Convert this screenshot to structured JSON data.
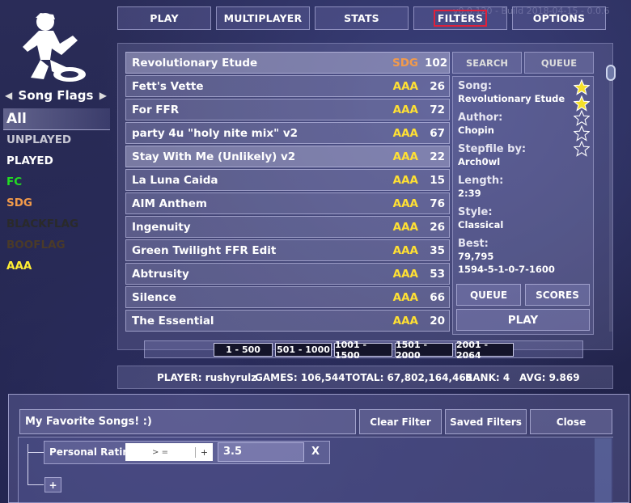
{
  "build_text": "v0.0.120 - Build 2018-04-15 - 0.0.6",
  "nav": {
    "play": "PLAY",
    "multiplayer": "MULTIPLAYER",
    "stats": "STATS",
    "filters": "FILTERS",
    "options": "OPTIONS"
  },
  "sidebar": {
    "title": "Song Flags",
    "items": [
      {
        "label": "All",
        "color": "#ffffff"
      },
      {
        "label": "UNPLAYED",
        "color": "#c8c8d4"
      },
      {
        "label": "PLAYED",
        "color": "#ffffff"
      },
      {
        "label": "FC",
        "color": "#22dd22"
      },
      {
        "label": "SDG",
        "color": "#f29a4a"
      },
      {
        "label": "BLACKFLAG",
        "color": "#2a2a2a"
      },
      {
        "label": "BOOFLAG",
        "color": "#4a3a28"
      },
      {
        "label": "AAA",
        "color": "#ffee33"
      }
    ]
  },
  "songs": [
    {
      "title": "Revolutionary Etude",
      "grade": "SDG",
      "score": "102",
      "grade_color": "#f29a4a"
    },
    {
      "title": "Fett's Vette",
      "grade": "AAA",
      "score": "26",
      "grade_color": "#ffe033"
    },
    {
      "title": "For FFR",
      "grade": "AAA",
      "score": "72",
      "grade_color": "#ffe033"
    },
    {
      "title": "party 4u \"holy nite mix\" v2",
      "grade": "AAA",
      "score": "67",
      "grade_color": "#ffe033"
    },
    {
      "title": "Stay With Me (Unlikely) v2",
      "grade": "AAA",
      "score": "22",
      "grade_color": "#ffe033"
    },
    {
      "title": "La Luna Caida",
      "grade": "AAA",
      "score": "15",
      "grade_color": "#ffe033"
    },
    {
      "title": "AIM Anthem",
      "grade": "AAA",
      "score": "76",
      "grade_color": "#ffe033"
    },
    {
      "title": "Ingenuity",
      "grade": "AAA",
      "score": "26",
      "grade_color": "#ffe033"
    },
    {
      "title": "Green Twilight FFR Edit",
      "grade": "AAA",
      "score": "35",
      "grade_color": "#ffe033"
    },
    {
      "title": "Abtrusity",
      "grade": "AAA",
      "score": "53",
      "grade_color": "#ffe033"
    },
    {
      "title": "Silence",
      "grade": "AAA",
      "score": "66",
      "grade_color": "#ffe033"
    },
    {
      "title": "The Essential",
      "grade": "AAA",
      "score": "20",
      "grade_color": "#ffe033"
    }
  ],
  "tabs": {
    "search": "SEARCH",
    "queue": "QUEUE"
  },
  "info": {
    "song_label": "Song:",
    "song_value": "Revolutionary Etude",
    "author_label": "Author:",
    "author_value": "Chopin",
    "stepfile_label": "Stepfile by:",
    "stepfile_value": "Arch0wl",
    "length_label": "Length:",
    "length_value": "2:39",
    "style_label": "Style:",
    "style_value": "Classical",
    "best_label": "Best:",
    "best_score": "79,795",
    "best_judgements": "1594-5-1-0-7-1600",
    "rating_stars": 2,
    "rating_max": 5
  },
  "actions": {
    "queue": "QUEUE",
    "scores": "SCORES",
    "play": "PLAY"
  },
  "pages": [
    "1 - 500",
    "501 - 1000",
    "1001 - 1500",
    "1501 - 2000",
    "2001 - 2064"
  ],
  "stats": {
    "player": "PLAYER: rushyrulz",
    "games": "GAMES: 106,544",
    "total": "TOTAL: 67,802,164,465",
    "rank": "RANK: 4",
    "avg": "AVG: 9.869"
  },
  "filter_window": {
    "title": "My Favorite Songs!  :)",
    "clear": "Clear Filter",
    "saved": "Saved Filters",
    "close": "Close",
    "rule_label": "Personal Rating",
    "operator": "> =",
    "operator_btn": "+",
    "value": "3.5",
    "remove": "X",
    "add": "+"
  },
  "colors": {
    "star_fill": "#f5e02a",
    "filters_highlight": "#e0203a"
  }
}
